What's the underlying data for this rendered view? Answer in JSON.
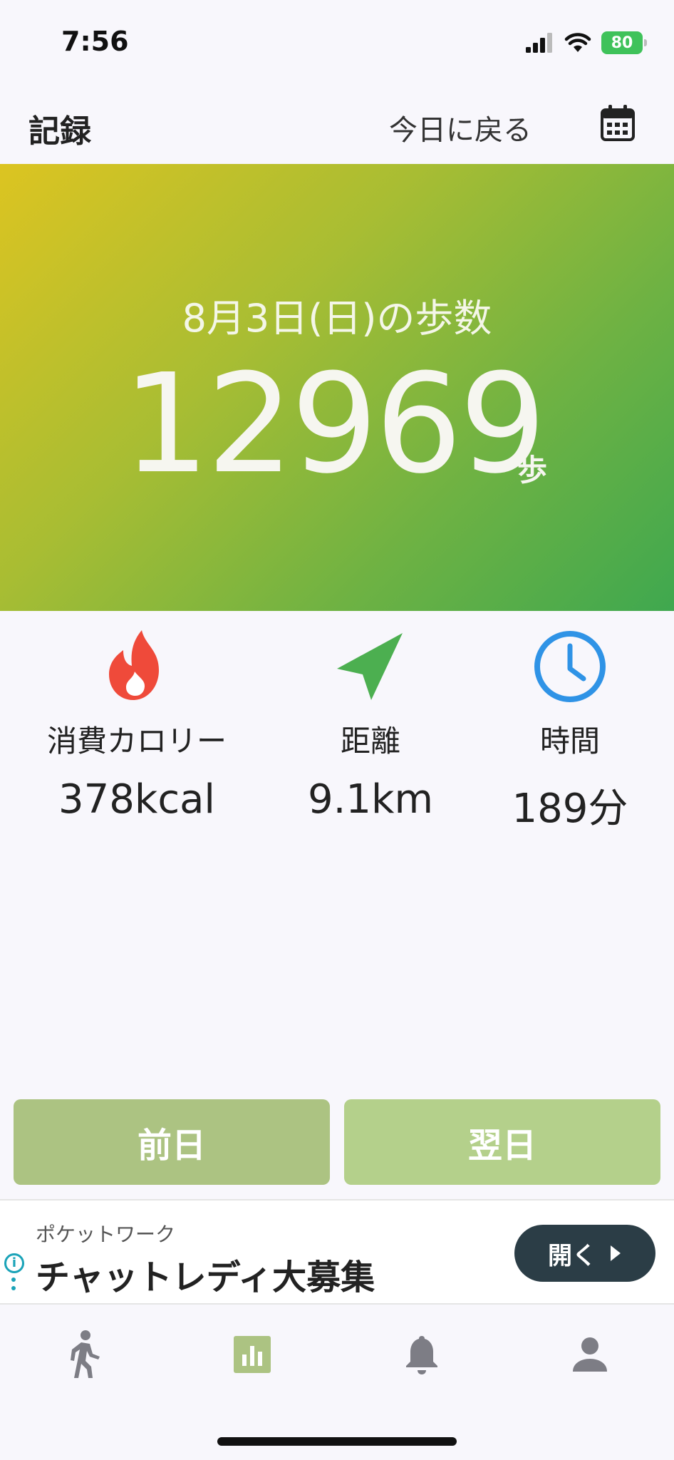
{
  "status_bar": {
    "time": "7:56",
    "battery": "80"
  },
  "header": {
    "title": "記録",
    "back_today_label": "今日に戻る"
  },
  "hero": {
    "date_label": "8月3日(日)の歩数",
    "steps": "12969",
    "steps_unit": "歩"
  },
  "stats": [
    {
      "label": "消費カロリー",
      "value": "378kcal",
      "icon": "flame-icon"
    },
    {
      "label": "距離",
      "value": "9.1km",
      "icon": "navigation-arrow-icon"
    },
    {
      "label": "時間",
      "value": "189分",
      "icon": "clock-icon"
    }
  ],
  "day_nav": {
    "prev_label": "前日",
    "next_label": "翌日"
  },
  "ad": {
    "source": "ポケットワーク",
    "headline": "チャットレディ大募集",
    "open_label": "開く"
  },
  "tabbar": {
    "tabs": [
      "walk-icon",
      "chart-icon",
      "bell-icon",
      "person-icon"
    ],
    "active_index": 1
  },
  "colors": {
    "accent": "#acc382",
    "hero_start": "#dcc421",
    "hero_end": "#3fa84f",
    "flame": "#ef4a3a",
    "nav_arrow": "#4caf50",
    "clock": "#2f93e6"
  }
}
